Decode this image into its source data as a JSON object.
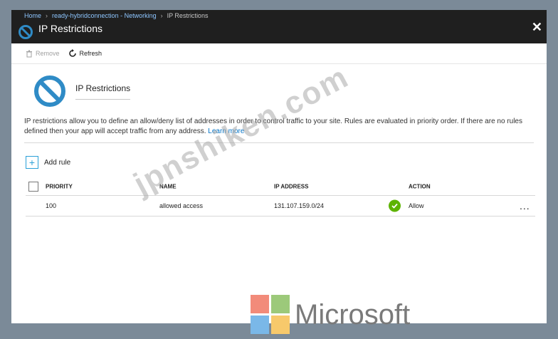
{
  "breadcrumb": {
    "home": "Home",
    "resource": "ready-hybridconnection - Networking",
    "current": "IP Restrictions"
  },
  "blade": {
    "title": "IP Restrictions",
    "close": "✕"
  },
  "toolbar": {
    "remove_label": "Remove",
    "refresh_label": "Refresh"
  },
  "hero": {
    "title": "IP Restrictions"
  },
  "description": {
    "text": "IP restrictions allow you to define an allow/deny list of addresses in order to control traffic to your site. Rules are evaluated in priority order. If there are no rules defined then your app will accept traffic from any address.",
    "learn_more": "Learn more"
  },
  "add_rule": {
    "label": "Add rule"
  },
  "table": {
    "headers": {
      "priority": "PRIORITY",
      "name": "NAME",
      "ip": "IP ADDRESS",
      "action": "ACTION"
    },
    "rows": [
      {
        "priority": "100",
        "name": "allowed access",
        "ip": "131.107.159.0/24",
        "action": "Allow",
        "more": "..."
      }
    ]
  },
  "watermark": "jpnshiken.com",
  "brand": {
    "name": "Microsoft"
  },
  "colors": {
    "check": "#5db300",
    "link": "#0072c6",
    "topbar": "#1f1f1f",
    "icon": "#2f8bc6"
  }
}
